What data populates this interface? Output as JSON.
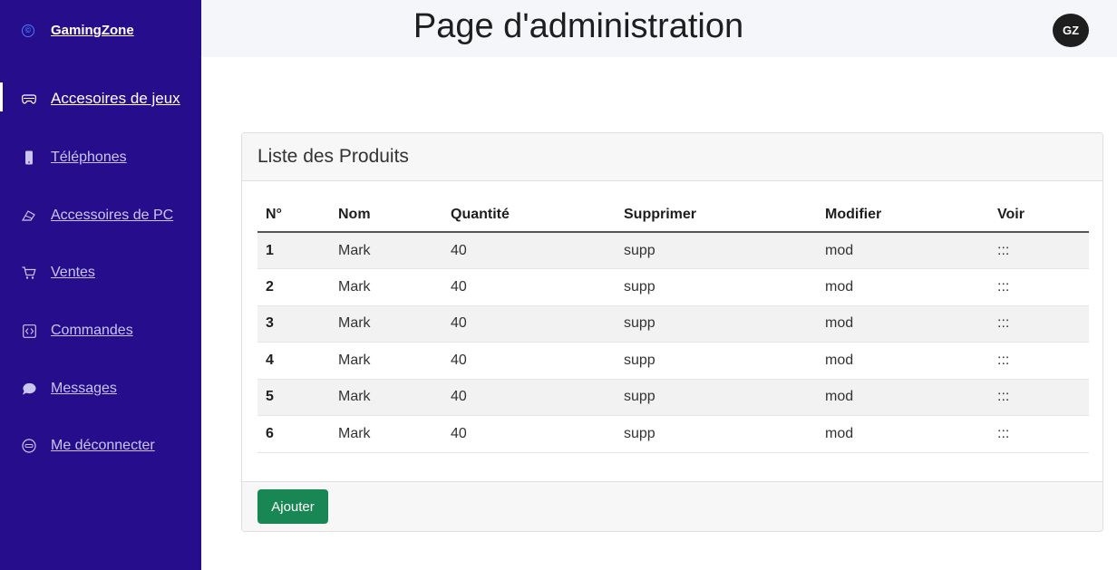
{
  "brand": {
    "name": "GamingZone",
    "icon": "copyright-icon"
  },
  "sidebar": {
    "items": [
      {
        "label": "Accesoires de jeux",
        "icon": "gamepad-icon",
        "active": true
      },
      {
        "label": "Téléphones",
        "icon": "phone-icon",
        "active": false
      },
      {
        "label": "Accessoires de PC",
        "icon": "mouse-icon",
        "active": false
      },
      {
        "label": "Ventes",
        "icon": "cart-icon",
        "active": false
      },
      {
        "label": "Commandes",
        "icon": "code-box-icon",
        "active": false
      },
      {
        "label": "Messages",
        "icon": "chat-bubble-icon",
        "active": false
      },
      {
        "label": "Me déconnecter",
        "icon": "logout-icon",
        "active": false
      }
    ]
  },
  "header": {
    "title": "Page d'administration",
    "avatar_initials": "GZ"
  },
  "card": {
    "title": "Liste des Produits",
    "columns": [
      "N°",
      "Nom",
      "Quantité",
      "Supprimer",
      "Modifier",
      "Voir"
    ],
    "rows": [
      [
        "1",
        "Mark",
        "40",
        "supp",
        "mod",
        ":::"
      ],
      [
        "2",
        "Mark",
        "40",
        "supp",
        "mod",
        ":::"
      ],
      [
        "3",
        "Mark",
        "40",
        "supp",
        "mod",
        ":::"
      ],
      [
        "4",
        "Mark",
        "40",
        "supp",
        "mod",
        ":::"
      ],
      [
        "5",
        "Mark",
        "40",
        "supp",
        "mod",
        ":::"
      ],
      [
        "6",
        "Mark",
        "40",
        "supp",
        "mod",
        ":::"
      ]
    ],
    "add_button_label": "Ajouter"
  },
  "colors": {
    "sidebar": "#260d8c",
    "topbar": "#f5f6fa",
    "accent_button": "#198754",
    "brand_icon": "#4b7bff"
  }
}
